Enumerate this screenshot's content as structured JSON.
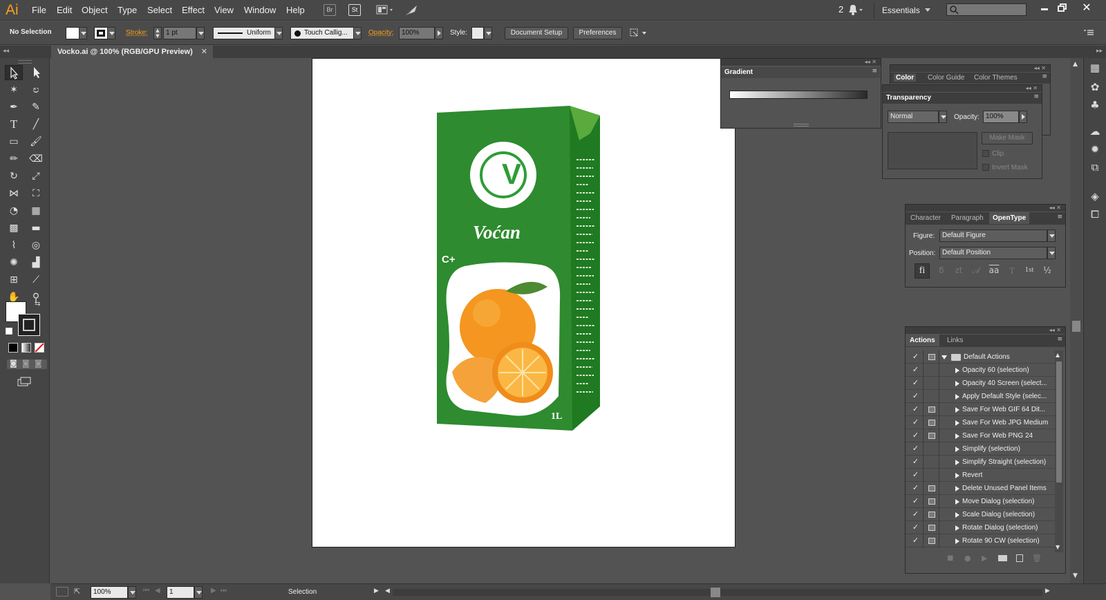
{
  "app": {
    "logo": "Ai",
    "menus": [
      "File",
      "Edit",
      "Object",
      "Type",
      "Select",
      "Effect",
      "View",
      "Window",
      "Help"
    ],
    "bridge_label": "Br",
    "stock_label": "St",
    "notification_count": "2",
    "workspace": "Essentials",
    "search_placeholder": ""
  },
  "control": {
    "selection": "No Selection",
    "stroke_label": "Stroke:",
    "stroke_weight": "1 pt",
    "stroke_profile": "Uniform",
    "brush": "Touch Callig...",
    "opacity_label": "Opacity:",
    "opacity_value": "100%",
    "style_label": "Style:",
    "document_setup": "Document Setup",
    "preferences": "Preferences"
  },
  "document": {
    "tab_title": "Vocko.ai @ 100% (RGB/GPU Preview)"
  },
  "artwork": {
    "brand": "Voćan",
    "badge": "C+",
    "logo_letter": "V",
    "volume": "1L"
  },
  "gradient_panel": {
    "title": "Gradient"
  },
  "color_panel": {
    "tabs": [
      "Color",
      "Color Guide",
      "Color Themes"
    ]
  },
  "transparency_panel": {
    "title": "Transparency",
    "blend_mode": "Normal",
    "opacity_label": "Opacity:",
    "opacity_value": "100%",
    "make_mask": "Make Mask",
    "clip": "Clip",
    "invert_mask": "Invert Mask"
  },
  "type_panel": {
    "tabs": [
      "Character",
      "Paragraph",
      "OpenType"
    ],
    "figure_label": "Figure:",
    "figure_value": "Default Figure",
    "position_label": "Position:",
    "position_value": "Default Position",
    "glyph_buttons": [
      "fi",
      "ϭ",
      "ƨt",
      "𝒜",
      "aa",
      "T",
      "1st",
      "½"
    ]
  },
  "actions_panel": {
    "tabs": [
      "Actions",
      "Links"
    ],
    "set_name": "Default Actions",
    "actions": [
      {
        "name": "Opacity 60 (selection)",
        "dialog": false
      },
      {
        "name": "Opacity 40 Screen (select...",
        "dialog": false
      },
      {
        "name": "Apply Default Style (selec...",
        "dialog": false
      },
      {
        "name": "Save For Web GIF 64 Dit...",
        "dialog": true
      },
      {
        "name": "Save For Web JPG Medium",
        "dialog": true
      },
      {
        "name": "Save For Web PNG 24",
        "dialog": true
      },
      {
        "name": "Simplify (selection)",
        "dialog": false
      },
      {
        "name": "Simplify Straight (selection)",
        "dialog": false
      },
      {
        "name": "Revert",
        "dialog": false
      },
      {
        "name": "Delete Unused Panel Items",
        "dialog": true
      },
      {
        "name": "Move Dialog (selection)",
        "dialog": true
      },
      {
        "name": "Scale Dialog (selection)",
        "dialog": true
      },
      {
        "name": "Rotate Dialog (selection)",
        "dialog": true
      },
      {
        "name": "Rotate 90 CW (selection)",
        "dialog": true
      }
    ]
  },
  "status": {
    "zoom": "100%",
    "artboard_number": "1",
    "tool_name": "Selection"
  },
  "colors": {
    "accent": "#f7a21b",
    "carton_green": "#2e8b2f"
  }
}
